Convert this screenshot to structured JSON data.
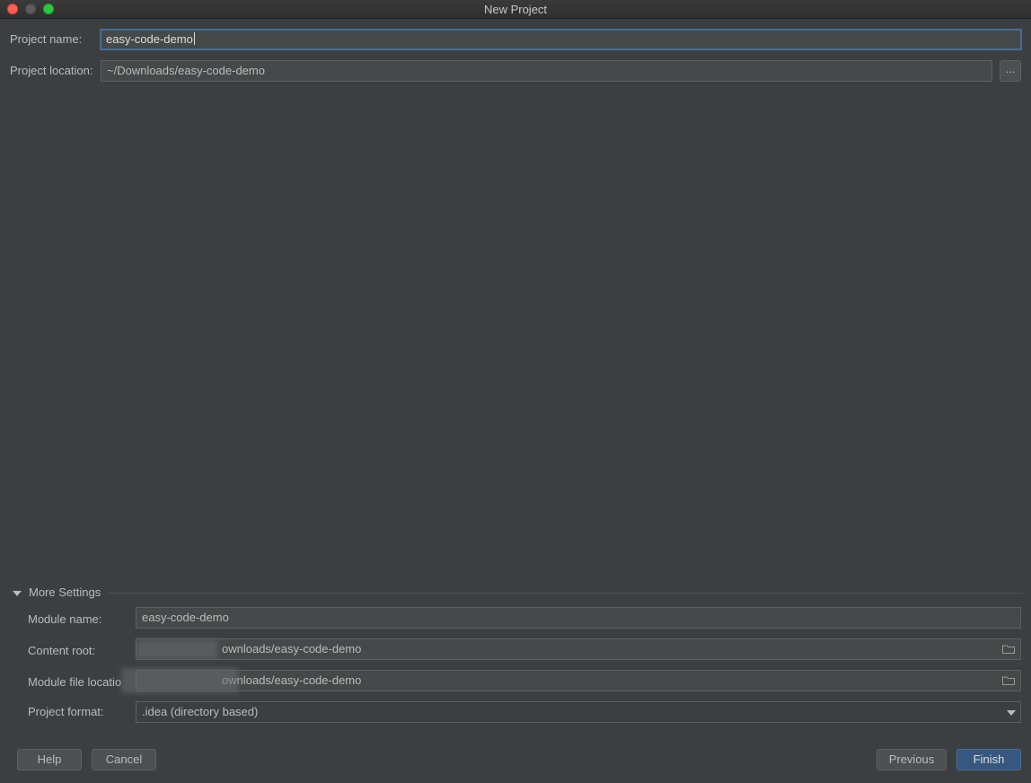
{
  "window": {
    "title": "New Project"
  },
  "project": {
    "name_label": "Project name:",
    "name_value": "easy-code-demo",
    "location_label": "Project location:",
    "location_value": "~/Downloads/easy-code-demo",
    "browse_label": "..."
  },
  "more_settings": {
    "header": "More Settings",
    "module_name_label": "Module name:",
    "module_name_value": "easy-code-demo",
    "content_root_label": "Content root:",
    "content_root_value": "ownloads/easy-code-demo",
    "module_file_location_label": "Module file locatio",
    "module_file_location_value": "ownloads/easy-code-demo",
    "project_format_label": "Project format:",
    "project_format_value": ".idea (directory based)"
  },
  "buttons": {
    "help": "Help",
    "cancel": "Cancel",
    "previous": "Previous",
    "finish": "Finish"
  },
  "icons": {
    "folder": "folder-icon",
    "dropdown": "chevron-down-icon",
    "disclosure": "disclosure-triangle-icon"
  },
  "colors": {
    "background": "#3c3f41",
    "field": "#45494a",
    "focus_border": "#466d94",
    "primary_button": "#365880"
  }
}
